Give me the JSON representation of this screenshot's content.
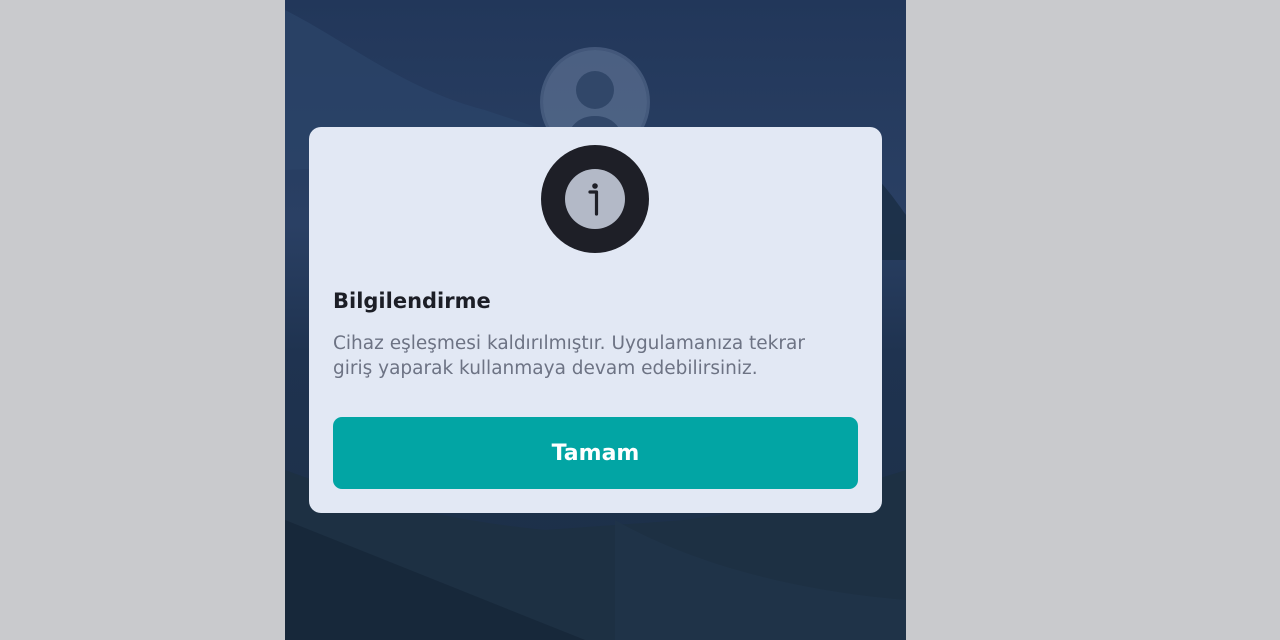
{
  "colors": {
    "page_background": "#c9cacd",
    "overlay": "#24385a",
    "dialog_background": "#e2e8f4",
    "button_background": "#02a5a4",
    "button_text": "#ffffff",
    "title_text": "#1c1e26",
    "message_text": "#6d7384",
    "info_badge_outer": "#1e1f27",
    "info_badge_inner": "#b3b9c7"
  },
  "background": {
    "avatar_icon": "user-avatar-icon"
  },
  "dialog": {
    "icon": "info-icon",
    "title": "Bilgilendirme",
    "message": "Cihaz eşleşmesi kaldırılmıştır. Uygulamanıza tekrar giriş yaparak kullanmaya devam edebilirsiniz.",
    "button_label": "Tamam"
  }
}
